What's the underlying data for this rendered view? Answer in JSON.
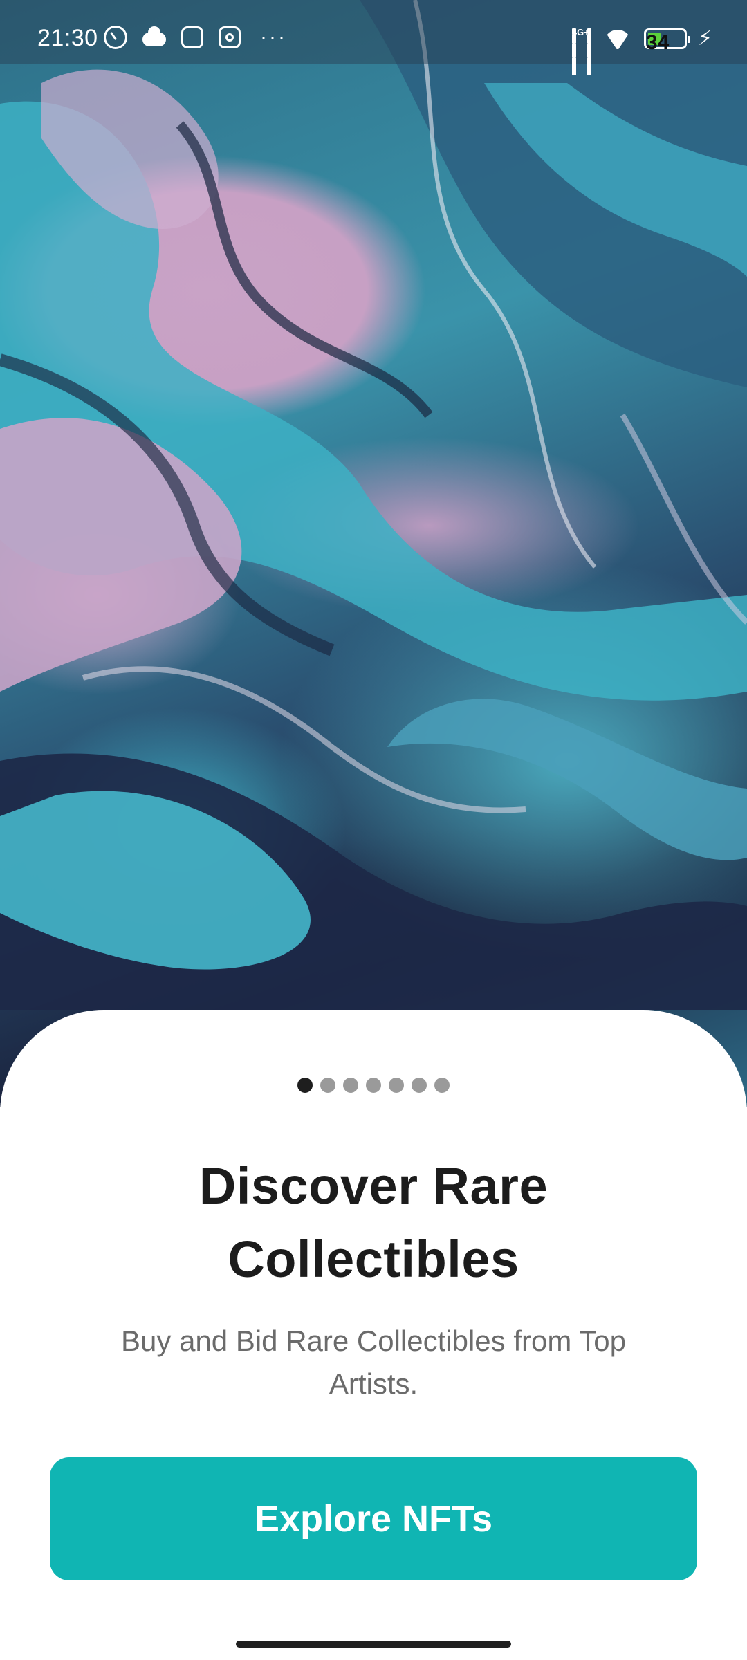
{
  "status_bar": {
    "time": "21:30",
    "network_label": "4G+",
    "battery_level": "34",
    "battery_fraction": 0.34,
    "left_icons": [
      "alarm-icon",
      "cloud-icon",
      "link-app-icon",
      "instagram-icon",
      "more-dots-icon"
    ],
    "right_icons": [
      "signal-4g-icon",
      "signal-icon",
      "wifi-icon",
      "battery-icon",
      "charging-icon"
    ],
    "more_dots": "···",
    "charging_glyph": "⚡"
  },
  "hero": {
    "image_description_icon": "marbled-art-image",
    "colors": {
      "pink": "#c7a0c4",
      "teal": "#3fb1c6",
      "navy": "#1b2540"
    }
  },
  "onboarding": {
    "page_count": 7,
    "active_page": 1,
    "title": "Discover Rare Collectibles",
    "subtitle": "Buy and Bid Rare Collectibles from Top Artists.",
    "cta_label": "Explore NFTs"
  },
  "theme": {
    "accent": "#10b5b3",
    "title_color": "#1c1c1c",
    "subtitle_color": "#6b6b6b",
    "dot_active": "#1e1e1e",
    "dot_inactive": "#9a9a9a"
  }
}
